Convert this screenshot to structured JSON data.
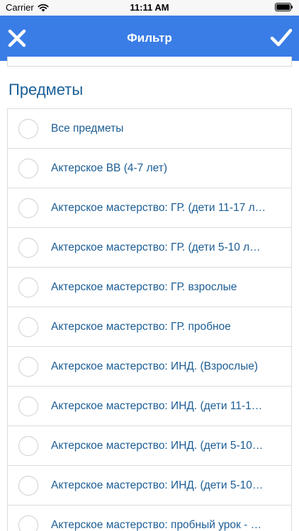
{
  "status_bar": {
    "carrier": "Carrier",
    "time": "11:11 AM",
    "battery_percent": 100
  },
  "nav": {
    "title": "Фильтр",
    "close_icon": "close-icon",
    "confirm_icon": "checkmark-icon"
  },
  "section": {
    "title": "Предметы"
  },
  "subjects": [
    {
      "label": "Все предметы",
      "selected": false
    },
    {
      "label": "Актерское ВВ (4-7 лет)",
      "selected": false
    },
    {
      "label": "Актерское мастерство: ГР. (дети 11-17 л…",
      "selected": false
    },
    {
      "label": "Актерское мастерство: ГР. (дети 5-10 л…",
      "selected": false
    },
    {
      "label": "Актерское мастерство: ГР. взрослые",
      "selected": false
    },
    {
      "label": "Актерское мастерство: ГР. пробное",
      "selected": false
    },
    {
      "label": "Актерское мастерство: ИНД. (Взрослые)",
      "selected": false
    },
    {
      "label": "Актерское мастерство: ИНД. (дети 11-1…",
      "selected": false
    },
    {
      "label": "Актерское мастерство: ИНД. (дети 5-10…",
      "selected": false
    },
    {
      "label": "Актерское мастерство: ИНД. (дети 5-10…",
      "selected": false
    },
    {
      "label": "Актерское мастерство: пробный урок - …",
      "selected": false
    }
  ],
  "colors": {
    "nav_background": "#3a7de6",
    "label_text": "#1c5d94",
    "section_title": "#1a5f96"
  }
}
